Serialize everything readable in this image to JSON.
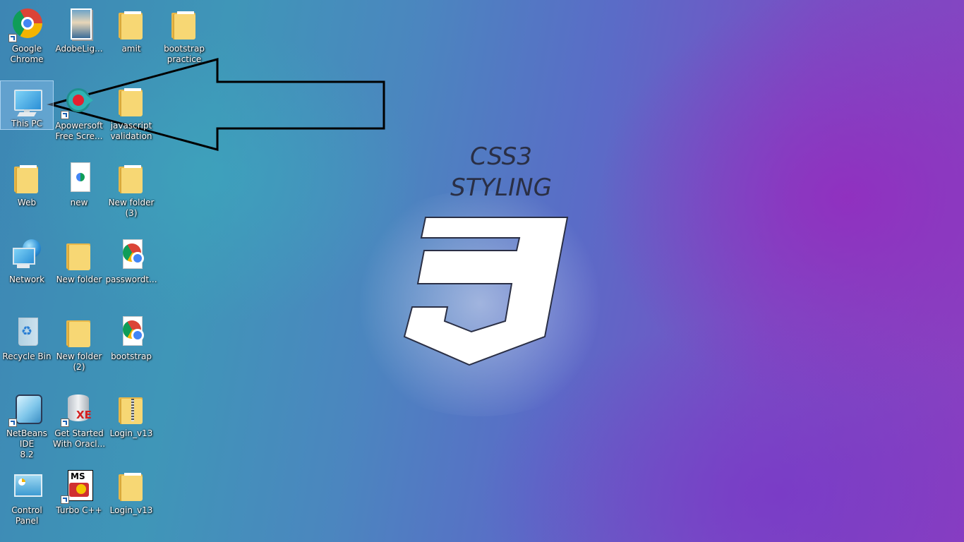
{
  "wallpaper": {
    "title_line1": "CSS3",
    "title_line2": "STYLING",
    "colors": {
      "left": "#3d86b4",
      "right": "#8a3fc0"
    }
  },
  "icons": [
    {
      "label": "Google\nChrome",
      "icon": "chrome-icon",
      "shortcut": true
    },
    {
      "label": "AdobeLig...",
      "icon": "adobe-lightroom-icon",
      "shortcut": false
    },
    {
      "label": "amit",
      "icon": "folder-icon",
      "shortcut": false
    },
    {
      "label": "bootstrap\npractice",
      "icon": "folder-chrome-icon",
      "shortcut": false
    },
    {
      "label": "This PC",
      "icon": "this-pc-icon",
      "shortcut": false,
      "selected": true
    },
    {
      "label": "Apowersoft\nFree Scre...",
      "icon": "apowersoft-icon",
      "shortcut": true
    },
    {
      "label": "javascript\nvalidation",
      "icon": "folder-chrome-icon",
      "shortcut": false
    },
    {
      "label": "Web",
      "icon": "folder-icon",
      "shortcut": false
    },
    {
      "label": "new",
      "icon": "document-icon",
      "shortcut": false
    },
    {
      "label": "New folder\n(3)",
      "icon": "folder-icon",
      "shortcut": false
    },
    {
      "label": "Network",
      "icon": "network-icon",
      "shortcut": false
    },
    {
      "label": "New folder",
      "icon": "folder-icon",
      "shortcut": false
    },
    {
      "label": "passwordt...",
      "icon": "chrome-document-icon",
      "shortcut": false
    },
    {
      "label": "Recycle Bin",
      "icon": "recycle-bin-icon",
      "shortcut": false
    },
    {
      "label": "New folder\n(2)",
      "icon": "folder-icon",
      "shortcut": false
    },
    {
      "label": "bootstrap",
      "icon": "chrome-document-icon",
      "shortcut": false
    },
    {
      "label": "NetBeans IDE\n8.2",
      "icon": "netbeans-icon",
      "shortcut": true
    },
    {
      "label": "Get Started\nWith Oracl...",
      "icon": "oracle-db-icon",
      "shortcut": true
    },
    {
      "label": "Login_v13",
      "icon": "zip-folder-icon",
      "shortcut": false
    },
    {
      "label": "Control\nPanel",
      "icon": "control-panel-icon",
      "shortcut": false
    },
    {
      "label": "Turbo C++",
      "icon": "turbo-cpp-icon",
      "shortcut": true
    },
    {
      "label": "Login_v13",
      "icon": "folder-icon",
      "shortcut": false
    }
  ]
}
